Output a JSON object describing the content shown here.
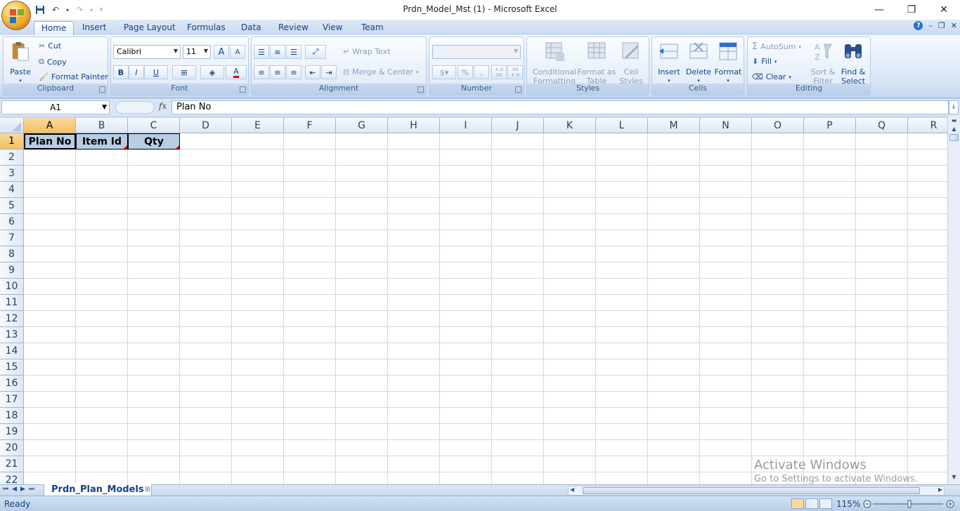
{
  "window": {
    "title": "Prdn_Model_Mst (1) - Microsoft Excel",
    "minimize": "—",
    "restore": "❐",
    "close": "✕"
  },
  "tabs": [
    "Home",
    "Insert",
    "Page Layout",
    "Formulas",
    "Data",
    "Review",
    "View",
    "Team"
  ],
  "active_tab": "Home",
  "ribbon": {
    "clipboard": {
      "title": "Clipboard",
      "paste": "Paste",
      "cut": "Cut",
      "copy": "Copy",
      "format_painter": "Format Painter"
    },
    "font": {
      "title": "Font",
      "name": "Calibri",
      "size": "11",
      "bold": "B",
      "italic": "I",
      "underline": "U",
      "grow": "A",
      "shrink": "A",
      "font_color": "A"
    },
    "alignment": {
      "title": "Alignment",
      "wrap_text": "Wrap Text",
      "merge_center": "Merge & Center"
    },
    "number": {
      "title": "Number",
      "format_value": "",
      "percent": "%",
      "comma": ",",
      "inc_decimal": "+.0\n.00",
      "dec_decimal": ".00\n+.0"
    },
    "styles": {
      "title": "Styles",
      "conditional_formatting": "Conditional Formatting",
      "format_as_table": "Format as Table",
      "cell_styles": "Cell Styles"
    },
    "cells": {
      "title": "Cells",
      "insert": "Insert",
      "delete": "Delete",
      "format": "Format"
    },
    "editing": {
      "title": "Editing",
      "autosum": "AutoSum",
      "fill": "Fill",
      "clear": "Clear",
      "sort_filter": "Sort & Filter",
      "find_select": "Find & Select"
    }
  },
  "formula_bar": {
    "name_box": "A1",
    "fx": "fx",
    "value": "Plan No"
  },
  "grid": {
    "columns": [
      "A",
      "B",
      "C",
      "D",
      "E",
      "F",
      "G",
      "H",
      "I",
      "J",
      "K",
      "L",
      "M",
      "N",
      "O",
      "P",
      "Q",
      "R"
    ],
    "rows": [
      "1",
      "2",
      "3",
      "4",
      "5",
      "6",
      "7",
      "8",
      "9",
      "10",
      "11",
      "12",
      "13",
      "14",
      "15",
      "16",
      "17",
      "18",
      "19",
      "20",
      "21",
      "22"
    ],
    "header_cells": [
      "Plan No",
      "Item Id",
      "Qty"
    ],
    "active_cell": "A1"
  },
  "sheets": {
    "active": "Prdn_Plan_Models"
  },
  "status": {
    "ready": "Ready",
    "zoom": "115%"
  },
  "watermark": {
    "line1": "Activate Windows",
    "line2": "Go to Settings to activate Windows."
  },
  "colors": {
    "accent": "#15428b",
    "header_fill": "#b8cce4",
    "selection_header": "#f1c15f"
  }
}
